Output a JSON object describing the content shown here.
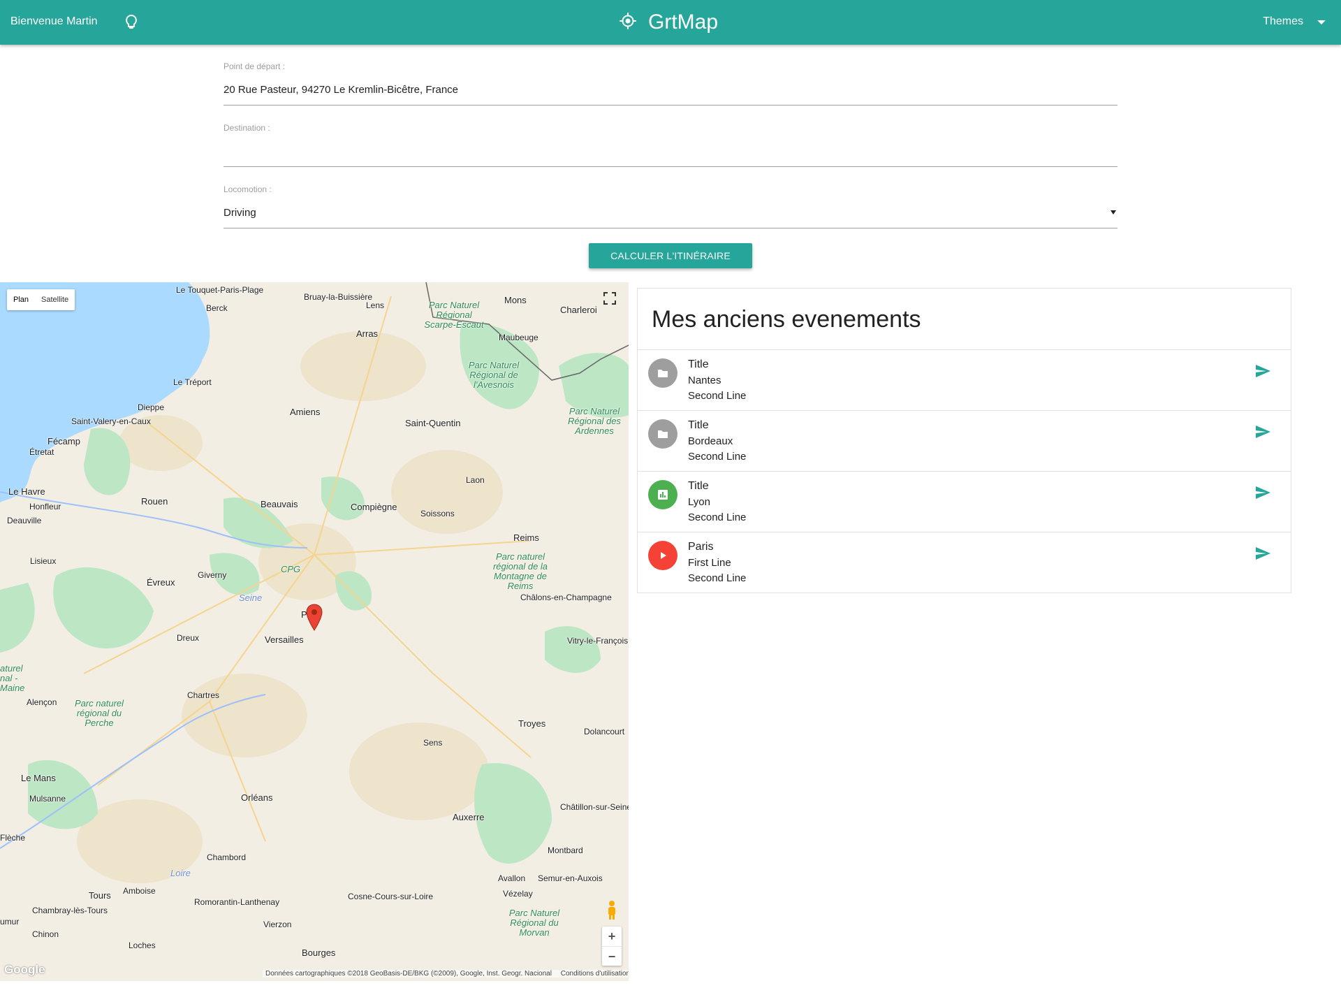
{
  "header": {
    "welcome": "Bienvenue Martin",
    "bulb_icon": "lightbulb-icon",
    "brand_icon": "gps-fixed-icon",
    "brand": "GrtMap",
    "themes_label": "Themes",
    "accent_color": "#26a69a"
  },
  "form": {
    "departure": {
      "label": "Point de départ :",
      "value": "20 Rue Pasteur, 94270 Le Kremlin-Bicêtre, France"
    },
    "destination": {
      "label": "Destination :",
      "value": ""
    },
    "locomotion": {
      "label": "Locomotion :",
      "value": "Driving"
    },
    "submit_label": "Calculer l'itinéraire"
  },
  "map": {
    "type_options": [
      "Plan",
      "Satellite"
    ],
    "selected_type": "Plan",
    "attribution": "Données cartographiques ©2018 GeoBasis-DE/BKG (©2009), Google, Inst. Geogr. Nacional",
    "terms": "Conditions d'utilisation",
    "logo": "Google",
    "zoom_in": "+",
    "zoom_out": "−",
    "places": {
      "le_touquet": "Le Touquet-Paris-Plage",
      "bruay": "Bruay-la-Buissière",
      "berck": "Berck",
      "lens": "Lens",
      "mons": "Mons",
      "charleroi": "Charleroi",
      "arras": "Arras",
      "maubeuge": "Maubeuge",
      "le_treport": "Le Tréport",
      "dieppe": "Dieppe",
      "amiens": "Amiens",
      "saint_quentin": "Saint-Quentin",
      "saint_valery": "Saint-Valery-en-Caux",
      "fecamp": "Fécamp",
      "etretat": "Étretat",
      "le_havre": "Le Havre",
      "honfleur": "Honfleur",
      "deauville": "Deauville",
      "rouen": "Rouen",
      "beauvais": "Beauvais",
      "compiegne": "Compiègne",
      "soissons": "Soissons",
      "laon": "Laon",
      "reims": "Reims",
      "lisieux": "Lisieux",
      "giverny": "Giverny",
      "evreux": "Évreux",
      "paris": "Paris",
      "versailles": "Versailles",
      "dreux": "Dreux",
      "chalons": "Châlons-en-Champagne",
      "vitry": "Vitry-le-François",
      "chartres": "Chartres",
      "alencon": "Alençon",
      "troyes": "Troyes",
      "dolancourt": "Dolancourt",
      "sens": "Sens",
      "le_mans": "Le Mans",
      "mulsanne": "Mulsanne",
      "orleans": "Orléans",
      "auxerre": "Auxerre",
      "chatillon": "Châtillon-sur-Seine",
      "la_fleche": "Flèche",
      "chambord": "Chambord",
      "montbard": "Montbard",
      "avallon": "Avallon",
      "semur": "Semur-en-Auxois",
      "vezelay": "Vézelay",
      "tours": "Tours",
      "amboise": "Amboise",
      "romorantin": "Romorantin-Lanthenay",
      "cosne": "Cosne-Cours-sur-Loire",
      "chambray": "Chambray-lès-Tours",
      "vierzon": "Vierzon",
      "chinon": "Chinon",
      "loches": "Loches",
      "bourges": "Bourges",
      "saumur": "umur",
      "cpg": "CPG",
      "seine": "Seine",
      "loire": "Loire",
      "park_scarpe": "Parc Naturel Régional Scarpe-Escaut",
      "park_avesnois": "Parc Naturel Régional de l'Avesnois",
      "park_ardennes": "Parc Naturel Régional des Ardennes",
      "park_reims": "Parc naturel régional de la Montagne de Reims",
      "park_perche": "Parc naturel régional du Perche",
      "park_maine": "aturel nal -Maine",
      "park_morvan": "Parc Naturel Régional du Morvan"
    }
  },
  "events": {
    "title": "Mes anciens evenements",
    "items": [
      {
        "line1": "Title",
        "line2": "Nantes",
        "line3": "Second Line",
        "icon": "folder-icon",
        "color": "#9e9e9e",
        "action_icon": "send-icon"
      },
      {
        "line1": "Title",
        "line2": "Bordeaux",
        "line3": "Second Line",
        "icon": "folder-icon",
        "color": "#9e9e9e",
        "action_icon": "send-icon"
      },
      {
        "line1": "Title",
        "line2": "Lyon",
        "line3": "Second Line",
        "icon": "assessment-icon",
        "color": "#4caf50",
        "action_icon": "send-icon"
      },
      {
        "line1": "Paris",
        "line2": "First Line",
        "line3": "Second Line",
        "icon": "play-arrow-icon",
        "color": "#f44336",
        "action_icon": "send-icon"
      }
    ]
  }
}
